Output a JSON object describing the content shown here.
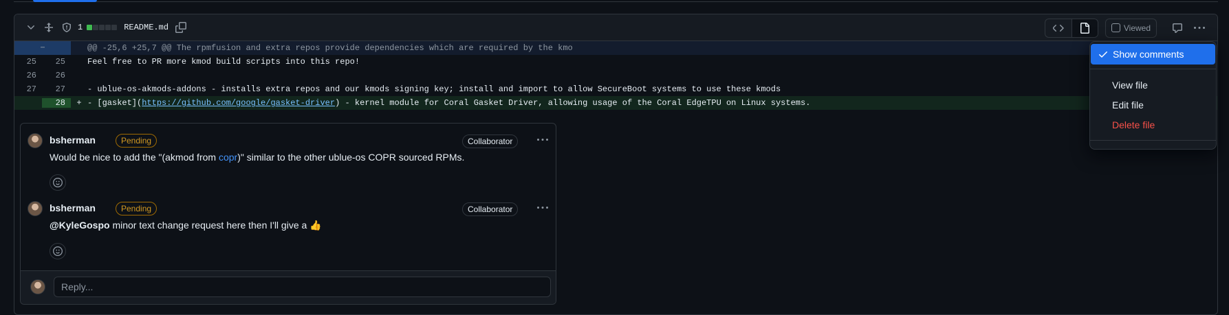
{
  "file": {
    "changes_count": "1",
    "diffstat": [
      "#3fb950",
      "#30363d",
      "#30363d",
      "#30363d",
      "#30363d"
    ],
    "name": "README.md",
    "viewed_label": "Viewed"
  },
  "diff": {
    "hunk_header": "@@ -25,6 +25,7 @@ The rpmfusion and extra repos provide dependencies which are required by the kmo",
    "expander_icon": "expand-up-icon",
    "lines": [
      {
        "old": "25",
        "new": "25",
        "sign": "",
        "text": "Feel free to PR more kmod build scripts into this repo!"
      },
      {
        "old": "26",
        "new": "26",
        "sign": "",
        "text": ""
      },
      {
        "old": "27",
        "new": "27",
        "sign": "",
        "text": "- ublue-os-akmods-addons - installs extra repos and our kmods signing key; install and import to allow SecureBoot systems to use these kmods"
      }
    ],
    "added_line": {
      "new": "28",
      "sign": "+",
      "prefix": "- [gasket](",
      "link": "https://github.com/google/gasket-driver",
      "suffix": ") - kernel module for Coral Gasket Driver, allowing usage of the Coral EdgeTPU on Linux systems."
    }
  },
  "thread": {
    "comments": [
      {
        "author": "bsherman",
        "status": "Pending",
        "role": "Collaborator",
        "body_before": "Would be nice to add the \"(akmod from ",
        "body_link": "copr",
        "body_after": ")\" similar to the other ublue-os COPR sourced RPMs."
      },
      {
        "author": "bsherman",
        "status": "Pending",
        "role": "Collaborator",
        "mention": "@KyleGospo",
        "body_after": " minor text change request here then I'll give a 👍"
      }
    ],
    "reply_placeholder": "Reply..."
  },
  "menu": {
    "items": [
      {
        "label": "Show comments",
        "checked": true
      },
      {
        "label": "View file"
      },
      {
        "label": "Edit file"
      },
      {
        "label": "Delete file",
        "danger": true
      }
    ]
  },
  "colors": {
    "accent": "#1f6feb",
    "danger": "#f85149",
    "pending": "#d29922",
    "link": "#4493f8"
  }
}
